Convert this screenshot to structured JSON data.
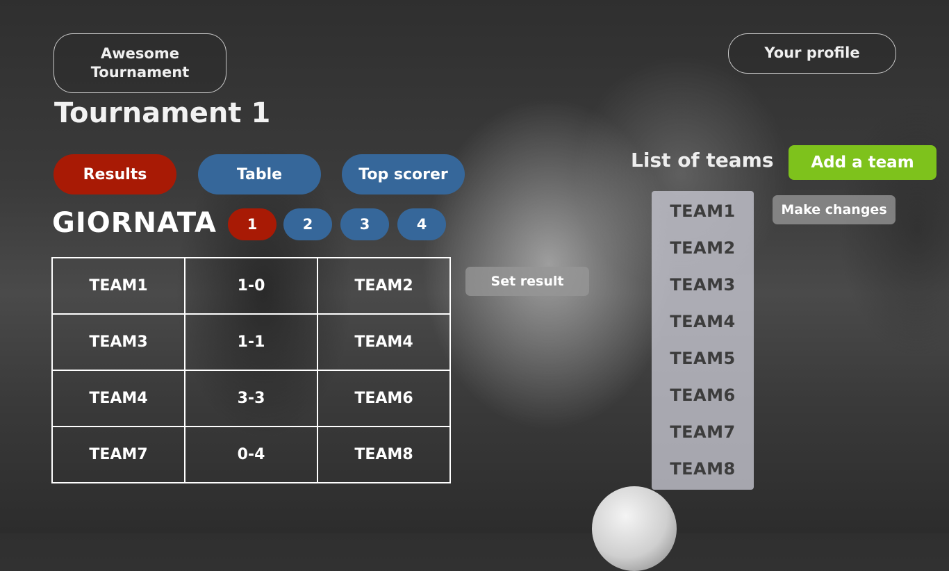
{
  "header": {
    "brand_label": "Awesome Tournament",
    "profile_label": "Your profile"
  },
  "page_title": "Tournament 1",
  "tabs": [
    {
      "label": "Results",
      "active": true
    },
    {
      "label": "Table",
      "active": false
    },
    {
      "label": "Top scorer",
      "active": false
    }
  ],
  "giornata": {
    "label": "GIORNATA",
    "rounds": [
      {
        "label": "1",
        "active": true
      },
      {
        "label": "2",
        "active": false
      },
      {
        "label": "3",
        "active": false
      },
      {
        "label": "4",
        "active": false
      }
    ]
  },
  "results": [
    {
      "home": "TEAM1",
      "score": "1-0",
      "away": "TEAM2"
    },
    {
      "home": "TEAM3",
      "score": "1-1",
      "away": "TEAM4"
    },
    {
      "home": "TEAM4",
      "score": "3-3",
      "away": "TEAM6"
    },
    {
      "home": "TEAM7",
      "score": "0-4",
      "away": "TEAM8"
    }
  ],
  "set_result_label": "Set result",
  "teams_panel": {
    "title": "List of teams",
    "add_label": "Add a team",
    "changes_label": "Make changes",
    "teams": [
      "TEAM1",
      "TEAM2",
      "TEAM3",
      "TEAM4",
      "TEAM5",
      "TEAM6",
      "TEAM7",
      "TEAM8"
    ]
  },
  "colors": {
    "active": "#a81a05",
    "inactive": "#36679a",
    "add": "#7ec21c",
    "neutral": "#969696"
  }
}
